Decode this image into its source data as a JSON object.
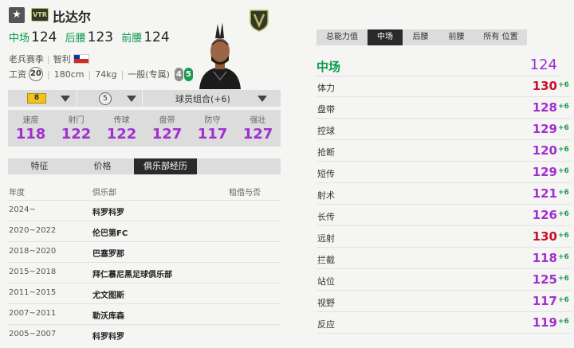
{
  "header": {
    "star": "★",
    "season_badge": "VTR",
    "name": "比达尔",
    "positions": [
      {
        "label": "中场",
        "value": "124"
      },
      {
        "label": "后腰",
        "value": "123"
      },
      {
        "label": "前腰",
        "value": "124"
      }
    ],
    "season": "老兵赛季",
    "nationality": "智利",
    "wage_label": "工资",
    "wage": "20",
    "height": "180cm",
    "weight": "74kg",
    "body_type": "一般(专属)",
    "weak_foot": "4",
    "strong_foot": "5"
  },
  "selectors": {
    "level": "8",
    "boost": "5",
    "combo": "球员组合(+6)"
  },
  "stats": [
    {
      "label": "速度",
      "value": "118"
    },
    {
      "label": "射门",
      "value": "122"
    },
    {
      "label": "传球",
      "value": "122"
    },
    {
      "label": "盘带",
      "value": "127"
    },
    {
      "label": "防守",
      "value": "117"
    },
    {
      "label": "强壮",
      "value": "127"
    }
  ],
  "tabs": [
    "特征",
    "价格",
    "俱乐部经历"
  ],
  "history": {
    "headers": [
      "年度",
      "俱乐部",
      "租借与否"
    ],
    "rows": [
      {
        "year": "2024~",
        "club": "科罗科罗"
      },
      {
        "year": "2020~2022",
        "club": "伦巴第FC"
      },
      {
        "year": "2018~2020",
        "club": "巴塞罗那"
      },
      {
        "year": "2015~2018",
        "club": "拜仁慕尼黑足球俱乐部"
      },
      {
        "year": "2011~2015",
        "club": "尤文图斯"
      },
      {
        "year": "2007~2011",
        "club": "勒沃库森"
      },
      {
        "year": "2005~2007",
        "club": "科罗科罗"
      }
    ]
  },
  "right": {
    "tabs": [
      "总能力值",
      "中场",
      "后腰",
      "前腰",
      "所有 位置"
    ],
    "position_label": "中场",
    "position_value": "124",
    "attributes": [
      {
        "name": "体力",
        "value": "130",
        "bonus": "+6",
        "color": "#c8102e"
      },
      {
        "name": "盘带",
        "value": "128",
        "bonus": "+6",
        "color": "#a030d0"
      },
      {
        "name": "控球",
        "value": "129",
        "bonus": "+6",
        "color": "#a030d0"
      },
      {
        "name": "抢断",
        "value": "120",
        "bonus": "+6",
        "color": "#a030d0"
      },
      {
        "name": "短传",
        "value": "129",
        "bonus": "+6",
        "color": "#a030d0"
      },
      {
        "name": "射术",
        "value": "121",
        "bonus": "+6",
        "color": "#a030d0"
      },
      {
        "name": "长传",
        "value": "126",
        "bonus": "+6",
        "color": "#a030d0"
      },
      {
        "name": "远射",
        "value": "130",
        "bonus": "+6",
        "color": "#c8102e"
      },
      {
        "name": "拦截",
        "value": "118",
        "bonus": "+6",
        "color": "#a030d0"
      },
      {
        "name": "站位",
        "value": "125",
        "bonus": "+6",
        "color": "#a030d0"
      },
      {
        "name": "视野",
        "value": "117",
        "bonus": "+6",
        "color": "#a030d0"
      },
      {
        "name": "反应",
        "value": "119",
        "bonus": "+6",
        "color": "#a030d0"
      }
    ]
  }
}
